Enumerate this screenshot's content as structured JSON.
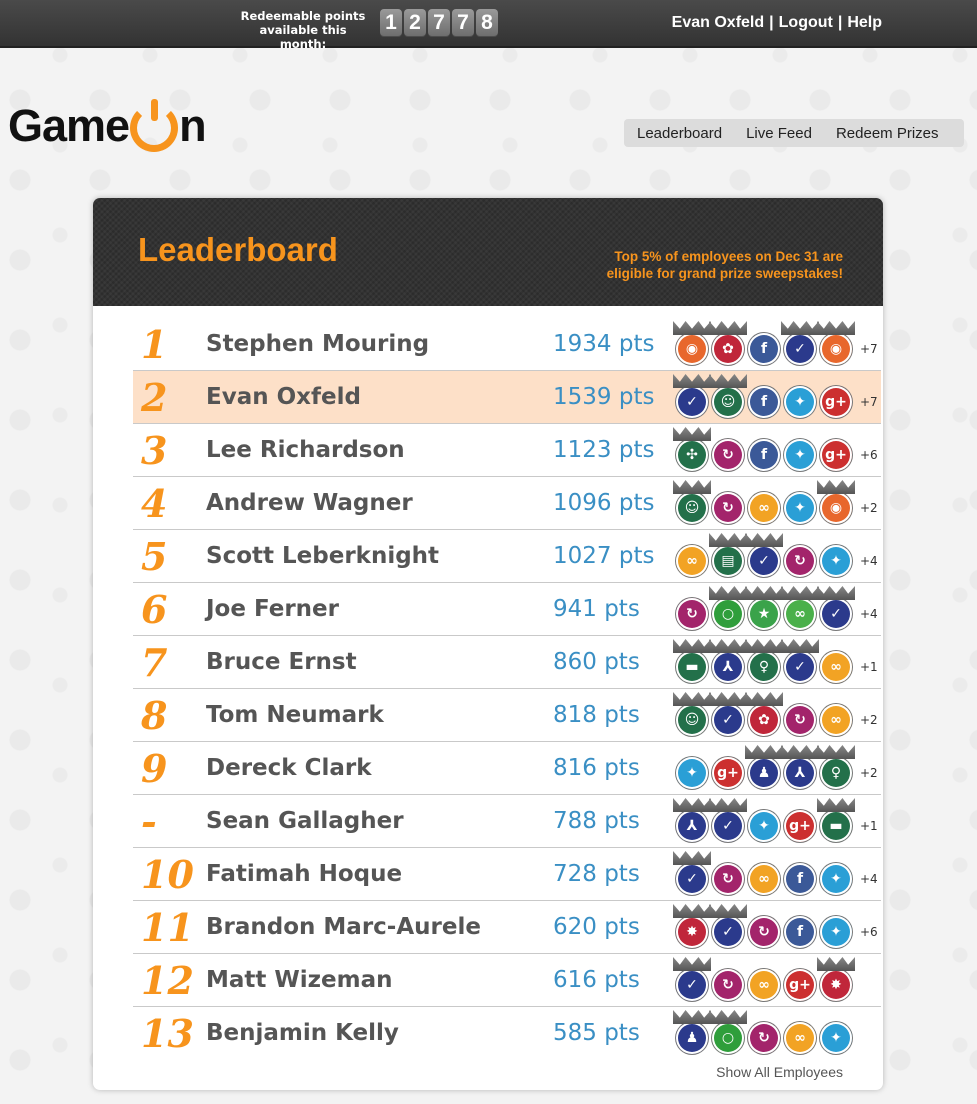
{
  "topbar": {
    "points_label_1": "Redeemable points",
    "points_label_2": "available this month:",
    "points_digits": [
      "1",
      "2",
      "7",
      "7",
      "8"
    ],
    "user": "Evan Oxfeld",
    "logout": "Logout",
    "help": "Help",
    "separator": "|"
  },
  "logo": {
    "part1": "Game",
    "part2": "n"
  },
  "nav": {
    "items": [
      "Leaderboard",
      "Live Feed",
      "Redeem Prizes"
    ]
  },
  "leaderboard": {
    "title": "Leaderboard",
    "note_line1": "Top 5% of employees on Dec 31 are",
    "note_line2": "eligible for grand prize sweepstakes!",
    "show_all": "Show All Employees",
    "rows": [
      {
        "rank": "1",
        "name": "Stephen Mouring",
        "pts": "1934 pts",
        "more": "+7",
        "badges": [
          "rss",
          "ribbon",
          "facebook",
          "check",
          "rss"
        ]
      },
      {
        "rank": "2",
        "name": "Evan Oxfeld",
        "pts": "1539 pts",
        "more": "+7",
        "badges": [
          "check",
          "people",
          "facebook",
          "twitter",
          "googleplus"
        ]
      },
      {
        "rank": "3",
        "name": "Lee Richardson",
        "pts": "1123 pts",
        "more": "+6",
        "badges": [
          "puzzle",
          "refresh",
          "facebook",
          "twitter",
          "googleplus"
        ]
      },
      {
        "rank": "4",
        "name": "Andrew Wagner",
        "pts": "1096 pts",
        "more": "+2",
        "badges": [
          "people",
          "refresh",
          "infinity",
          "twitter",
          "rss"
        ]
      },
      {
        "rank": "5",
        "name": "Scott Leberknight",
        "pts": "1027 pts",
        "more": "+4",
        "badges": [
          "infinity",
          "book",
          "check",
          "refresh",
          "twitter"
        ]
      },
      {
        "rank": "6",
        "name": "Joe Ferner",
        "pts": "941 pts",
        "more": "+4",
        "badges": [
          "refresh",
          "lock",
          "star",
          "link",
          "check"
        ]
      },
      {
        "rank": "7",
        "name": "Bruce Ernst",
        "pts": "860 pts",
        "more": "+1",
        "badges": [
          "chat",
          "merge",
          "bulb",
          "check",
          "infinity"
        ]
      },
      {
        "rank": "8",
        "name": "Tom Neumark",
        "pts": "818 pts",
        "more": "+2",
        "badges": [
          "people",
          "check",
          "ribbon",
          "refresh",
          "infinity"
        ]
      },
      {
        "rank": "9",
        "name": "Dereck Clark",
        "pts": "816 pts",
        "more": "+2",
        "badges": [
          "twitter",
          "googleplus",
          "user",
          "merge",
          "bulb"
        ]
      },
      {
        "rank": "-",
        "name": "Sean Gallagher",
        "pts": "788 pts",
        "more": "+1",
        "badges": [
          "merge",
          "check",
          "twitter",
          "googleplus",
          "chat"
        ]
      },
      {
        "rank": "10",
        "name": "Fatimah Hoque",
        "pts": "728 pts",
        "more": "+4",
        "badges": [
          "check",
          "refresh",
          "infinity",
          "facebook",
          "twitter"
        ]
      },
      {
        "rank": "11",
        "name": "Brandon Marc-Aurele",
        "pts": "620 pts",
        "more": "+6",
        "badges": [
          "burst",
          "check",
          "refresh",
          "facebook",
          "twitter"
        ]
      },
      {
        "rank": "12",
        "name": "Matt Wizeman",
        "pts": "616 pts",
        "more": "",
        "badges": [
          "check",
          "refresh",
          "infinity",
          "googleplus",
          "burst"
        ]
      },
      {
        "rank": "13",
        "name": "Benjamin Kelly",
        "pts": "585 pts",
        "more": "",
        "badges": [
          "user",
          "lock",
          "refresh",
          "infinity",
          "twitter"
        ]
      }
    ]
  },
  "badge_styles": {
    "rss": {
      "color": "#e8672c",
      "glyph": "◉",
      "crown": true
    },
    "ribbon": {
      "color": "#c0263a",
      "glyph": "✿",
      "crown": true
    },
    "facebook": {
      "color": "#3b5998",
      "glyph": "f",
      "crown": false
    },
    "check": {
      "color": "#2b3a8c",
      "glyph": "✓",
      "crown": true
    },
    "people": {
      "color": "#23704a",
      "glyph": "☺",
      "crown": true
    },
    "twitter": {
      "color": "#2a9fd6",
      "glyph": "✦",
      "crown": false
    },
    "googleplus": {
      "color": "#cc2f2f",
      "glyph": "g+",
      "crown": false
    },
    "puzzle": {
      "color": "#23704a",
      "glyph": "✣",
      "crown": true
    },
    "refresh": {
      "color": "#a3246b",
      "glyph": "↻",
      "crown": false
    },
    "infinity": {
      "color": "#f2a324",
      "glyph": "∞",
      "crown": false
    },
    "book": {
      "color": "#23704a",
      "glyph": "▤",
      "crown": true
    },
    "lock": {
      "color": "#2f9e3b",
      "glyph": "○",
      "crown": true
    },
    "star": {
      "color": "#3aa34a",
      "glyph": "★",
      "crown": true
    },
    "link": {
      "color": "#4ab04a",
      "glyph": "∞",
      "crown": true
    },
    "chat": {
      "color": "#23704a",
      "glyph": "▬",
      "crown": true
    },
    "merge": {
      "color": "#2b3a8c",
      "glyph": "⅄",
      "crown": true
    },
    "bulb": {
      "color": "#23704a",
      "glyph": "♀",
      "crown": true
    },
    "user": {
      "color": "#2b3a8c",
      "glyph": "♟",
      "crown": true
    },
    "burst": {
      "color": "#c0263a",
      "glyph": "✸",
      "crown": true
    }
  }
}
